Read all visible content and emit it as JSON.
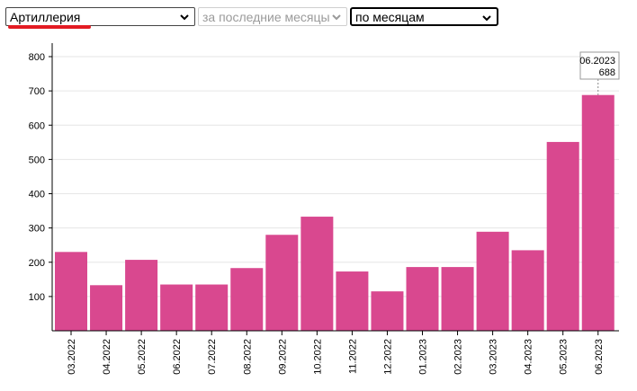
{
  "controls": {
    "category": "Артиллерия",
    "period": "за последние месяцы",
    "grouping": "по месяцам"
  },
  "colors": {
    "bar": "#d9488f",
    "grid": "#e6e6e6",
    "axis": "#000000",
    "highlight": "#e31b23"
  },
  "chart_data": {
    "type": "bar",
    "categories": [
      "03.2022",
      "04.2022",
      "05.2022",
      "06.2022",
      "07.2022",
      "08.2022",
      "09.2022",
      "10.2022",
      "11.2022",
      "12.2022",
      "01.2023",
      "02.2023",
      "03.2023",
      "04.2023",
      "05.2023",
      "06.2023"
    ],
    "values": [
      230,
      133,
      207,
      135,
      135,
      183,
      280,
      333,
      173,
      115,
      186,
      186,
      289,
      235,
      551,
      688
    ],
    "ylim": [
      0,
      800
    ],
    "yticks": [
      100,
      200,
      300,
      400,
      500,
      600,
      700,
      800
    ],
    "grid": true,
    "tooltip": {
      "label": "06.2023",
      "value": "688"
    }
  }
}
